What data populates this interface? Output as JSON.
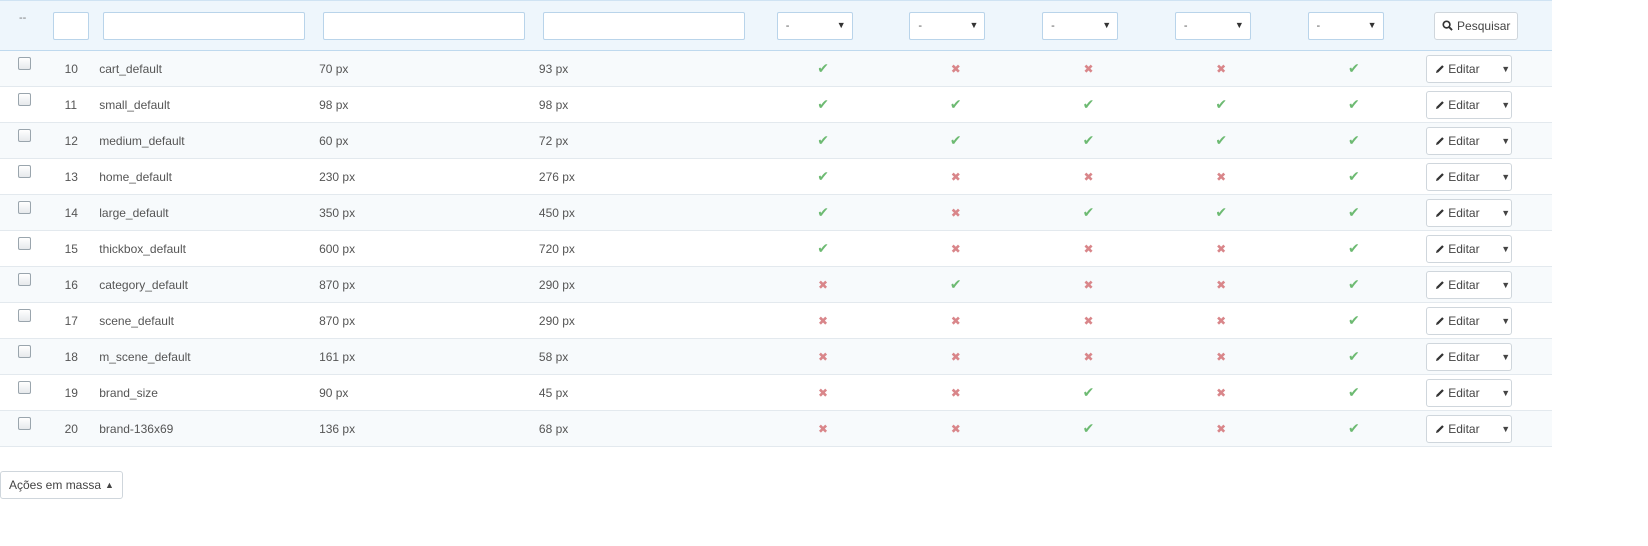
{
  "filters": {
    "header_dash": "--",
    "id_value": "",
    "name_value": "",
    "width_value": "",
    "height_value": "",
    "selects": [
      "-",
      "-",
      "-",
      "-",
      "-"
    ],
    "search_label": "Pesquisar"
  },
  "rows": [
    {
      "id": "10",
      "name": "cart_default",
      "width": "70 px",
      "height": "93 px",
      "flags": [
        true,
        false,
        false,
        false,
        true
      ]
    },
    {
      "id": "11",
      "name": "small_default",
      "width": "98 px",
      "height": "98 px",
      "flags": [
        true,
        true,
        true,
        true,
        true
      ]
    },
    {
      "id": "12",
      "name": "medium_default",
      "width": "60 px",
      "height": "72 px",
      "flags": [
        true,
        true,
        true,
        true,
        true
      ]
    },
    {
      "id": "13",
      "name": "home_default",
      "width": "230 px",
      "height": "276 px",
      "flags": [
        true,
        false,
        false,
        false,
        true
      ]
    },
    {
      "id": "14",
      "name": "large_default",
      "width": "350 px",
      "height": "450 px",
      "flags": [
        true,
        false,
        true,
        true,
        true
      ]
    },
    {
      "id": "15",
      "name": "thickbox_default",
      "width": "600 px",
      "height": "720 px",
      "flags": [
        true,
        false,
        false,
        false,
        true
      ]
    },
    {
      "id": "16",
      "name": "category_default",
      "width": "870 px",
      "height": "290 px",
      "flags": [
        false,
        true,
        false,
        false,
        true
      ]
    },
    {
      "id": "17",
      "name": "scene_default",
      "width": "870 px",
      "height": "290 px",
      "flags": [
        false,
        false,
        false,
        false,
        true
      ]
    },
    {
      "id": "18",
      "name": "m_scene_default",
      "width": "161 px",
      "height": "58 px",
      "flags": [
        false,
        false,
        false,
        false,
        true
      ]
    },
    {
      "id": "19",
      "name": "brand_size",
      "width": "90 px",
      "height": "45 px",
      "flags": [
        false,
        false,
        true,
        false,
        true
      ]
    },
    {
      "id": "20",
      "name": "brand-136x69",
      "width": "136 px",
      "height": "68 px",
      "flags": [
        false,
        false,
        true,
        false,
        true
      ]
    }
  ],
  "row_action_label": "Editar",
  "bulk_actions_label": "Ações em massa",
  "icons": {
    "ok": "check-icon",
    "no": "cross-icon",
    "search": "search-icon",
    "edit": "pencil-icon",
    "caret": "caret-down-icon"
  },
  "colors": {
    "ok": "#6dba72",
    "no": "#d9868a",
    "header_bg": "#eef6fc"
  }
}
